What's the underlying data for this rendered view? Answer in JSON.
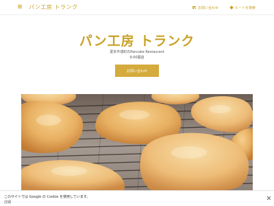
{
  "header": {
    "brand": "パン工房 トランク",
    "contact_label": "お問い合わせ",
    "route_label": "ルートを検索",
    "menu_icon": "hamburger-menu-icon",
    "contact_icon": "mail-icon",
    "route_icon": "directions-icon",
    "accent_color": "#c9a227"
  },
  "hero": {
    "title": "パン工房 トランク",
    "subtitle_line1": "愛本平成町のPancake Restaurant",
    "subtitle_line2": "9:00開店",
    "cta_label": "お問い合わせ",
    "cta_color": "#d4ab3c",
    "image_description": "bread-rolls-on-cooling-rack"
  },
  "cookie_bar": {
    "text": "このサイトでは Google の Cookie を使用しています。",
    "details_link": "詳細",
    "close_icon": "close-icon"
  }
}
